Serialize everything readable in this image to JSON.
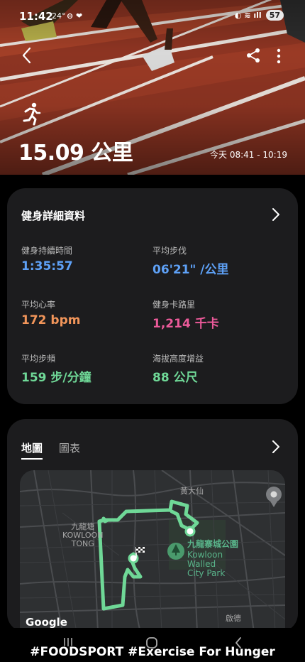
{
  "status_bar": {
    "time": "11:42",
    "temperature": "24°",
    "icons_left": "⊖ ❤",
    "signal": "◐ ≋ ıll",
    "battery": "57"
  },
  "hero": {
    "distance": "15.09 公里",
    "date_range": "今天 08:41 - 10:19",
    "icons": {
      "back": "chevron-left-icon",
      "share": "share-icon",
      "more": "more-vertical-icon",
      "activity": "running-icon"
    }
  },
  "details": {
    "title": "健身詳細資料",
    "stats": [
      {
        "label": "健身持續時間",
        "value": "1:35:57",
        "color": "#5ea1f7"
      },
      {
        "label": "平均步伐",
        "value": "06'21\" /公里",
        "color": "#5ea1f7"
      },
      {
        "label": "平均心率",
        "value": "172 bpm",
        "color": "#f1955a"
      },
      {
        "label": "健身卡路里",
        "value": "1,214 千卡",
        "color": "#ec5a9a"
      },
      {
        "label": "平均步頻",
        "value": "159 步/分鐘",
        "color": "#6fd897"
      },
      {
        "label": "海拔高度增益",
        "value": "88 公尺",
        "color": "#6fd897"
      }
    ]
  },
  "map_card": {
    "tabs": [
      {
        "label": "地圖",
        "active": true
      },
      {
        "label": "圖表",
        "active": false
      }
    ],
    "labels": {
      "wong_tai_sin": "黃大仙",
      "kowloon_tong": "九龍塘\nKOWLOON\nTONG",
      "park_zh": "九龍寨城公園",
      "park_en": "Kowloon\nWalled\nCity Park",
      "kai_tak": "啟德"
    },
    "google": "Google",
    "route_color": "#6fd897"
  },
  "nav": {
    "watermark": "#FOODSPORT  #Exercise  For Hunger"
  }
}
